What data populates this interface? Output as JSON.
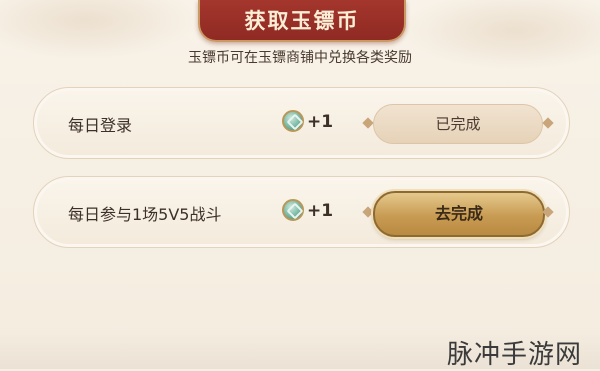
{
  "header": {
    "title": "获取玉镖币"
  },
  "description": "玉镖币可在玉镖商铺中兑换各类奖励",
  "tasks": [
    {
      "label": "每日登录",
      "reward": "+1",
      "reward_icon": "jade-coin-icon",
      "button_label": "已完成",
      "status": "completed"
    },
    {
      "label": "每日参与1场5V5战斗",
      "reward": "+1",
      "reward_icon": "jade-coin-icon",
      "button_label": "去完成",
      "status": "pending"
    }
  ],
  "watermark": "脉冲手游网",
  "colors": {
    "banner": "#a4362d",
    "panel": "#f6efe4",
    "button_gold": "#c89b53",
    "button_done": "#e6d2b8",
    "coin": "#76b7a3"
  }
}
